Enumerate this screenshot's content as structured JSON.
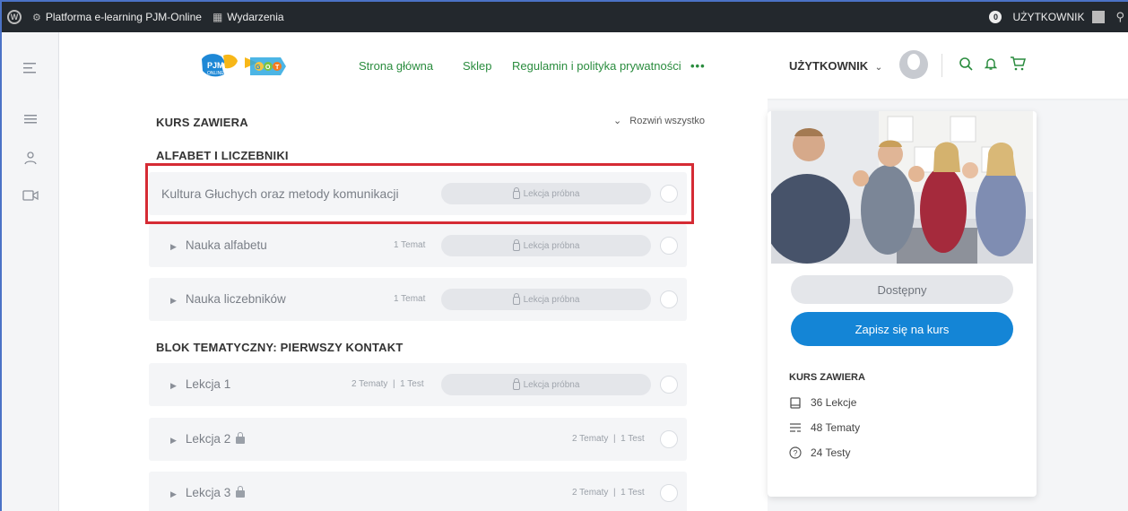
{
  "adminbar": {
    "site_name": "Platforma e-learning PJM-Online",
    "events_label": "Wydarzenia",
    "notifications_count": "0",
    "user_label": "UŻYTKOWNIK"
  },
  "header": {
    "nav": [
      "Strona główna",
      "Sklep",
      "Regulamin i polityka prywatności"
    ],
    "more": "•••",
    "user_label": "UŻYTKOWNIK",
    "accent": "#2a8c3e"
  },
  "content": {
    "section_label": "KURS ZAWIERA",
    "expand_all": "Rozwiń wszystko",
    "sections": [
      {
        "title": "ALFABET I LICZEBNIKI",
        "rows": [
          {
            "title": "Kultura Głuchych oraz metody komunikacji",
            "meta": "",
            "pill": "Lekcja próbna",
            "expandable": false,
            "locked": false
          },
          {
            "title": "Nauka alfabetu",
            "meta": "1 Temat",
            "pill": "Lekcja próbna",
            "expandable": true,
            "locked": false
          },
          {
            "title": "Nauka liczebników",
            "meta": "1 Temat",
            "pill": "Lekcja próbna",
            "expandable": true,
            "locked": false
          }
        ]
      },
      {
        "title": "BLOK TEMATYCZNY: PIERWSZY KONTAKT",
        "rows": [
          {
            "title": "Lekcja 1",
            "meta": "2 Tematy  |  1 Test",
            "pill": "Lekcja próbna",
            "expandable": true,
            "locked": false
          },
          {
            "title": "Lekcja 2",
            "meta": "2 Tematy  |  1 Test",
            "pill": "",
            "expandable": true,
            "locked": true
          },
          {
            "title": "Lekcja 3",
            "meta": "2 Tematy  |  1 Test",
            "pill": "",
            "expandable": true,
            "locked": true
          }
        ]
      }
    ]
  },
  "card": {
    "status": "Dostępny",
    "enroll": "Zapisz się na kurs",
    "includes_title": "KURS ZAWIERA",
    "stats": [
      {
        "icon": "book-icon",
        "label": "36 Lekcje"
      },
      {
        "icon": "topics-icon",
        "label": "48 Tematy"
      },
      {
        "icon": "question-icon",
        "label": "24 Testy"
      }
    ],
    "enroll_color": "#1485d6"
  }
}
